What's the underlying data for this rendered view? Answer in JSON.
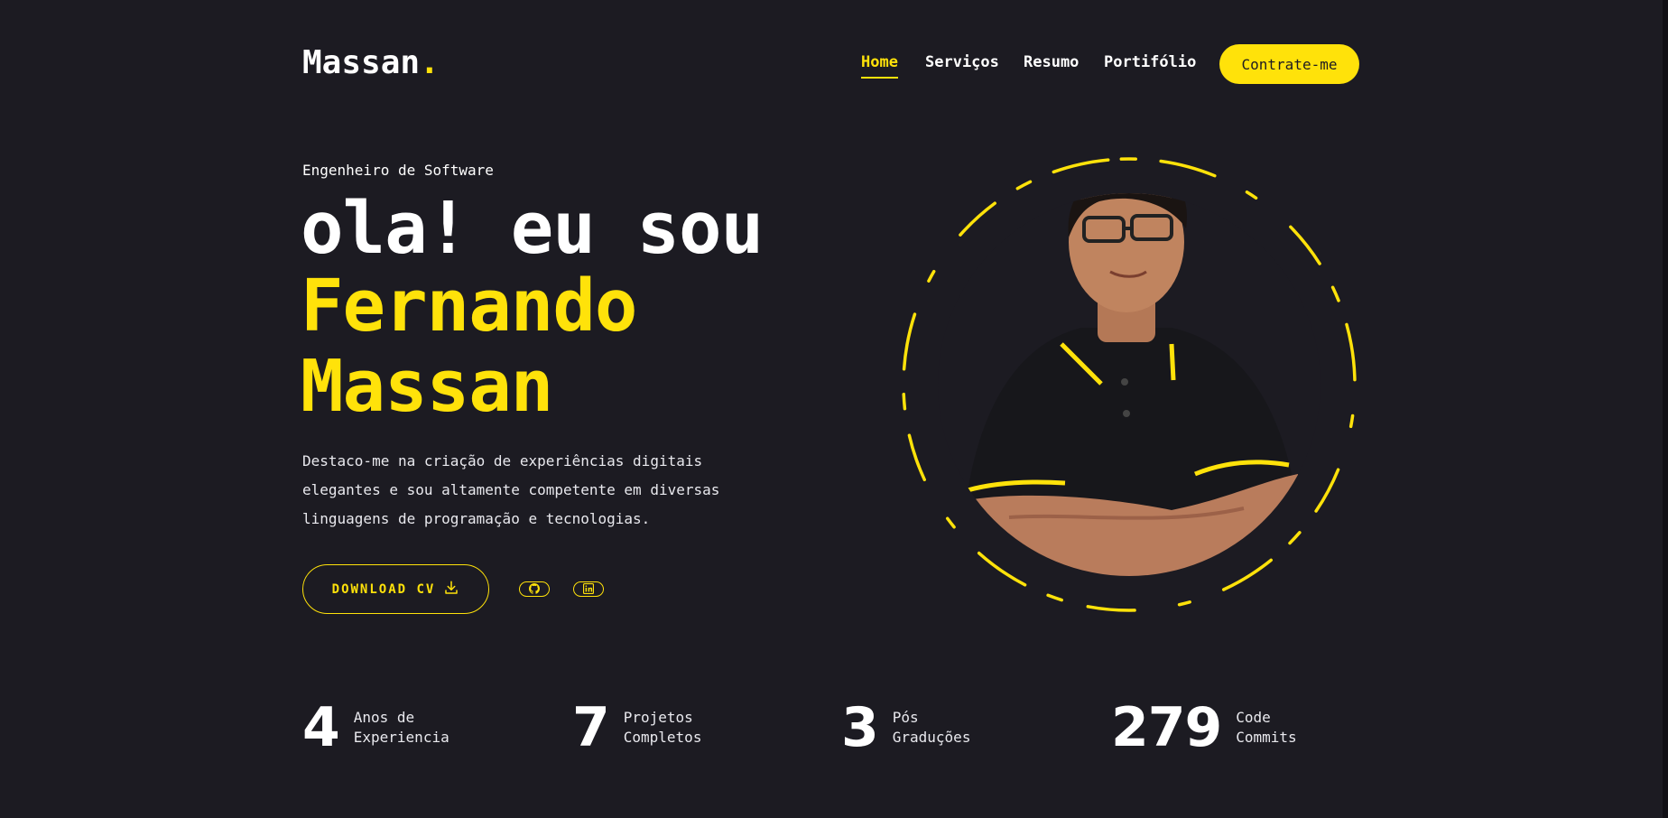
{
  "header": {
    "logo_text": "Massan",
    "logo_dot": ".",
    "nav": [
      {
        "label": "Home",
        "active": true
      },
      {
        "label": "Serviços",
        "active": false
      },
      {
        "label": "Resumo",
        "active": false
      },
      {
        "label": "Portifólio",
        "active": false
      }
    ],
    "hire_label": "Contrate-me"
  },
  "hero": {
    "subtitle": "Engenheiro de Software",
    "greeting": "ola! eu sou",
    "first_name": "Fernando",
    "last_name": "Massan",
    "description": [
      "Destaco-me na criação de experiências digitais",
      "elegantes e sou altamente competente em diversas",
      "linguagens de programação e tecnologias."
    ],
    "download_label": "DOWNLOAD CV",
    "download_icon": "download-icon",
    "social": [
      {
        "name": "github-icon"
      },
      {
        "name": "linkedin-icon"
      }
    ]
  },
  "stats": [
    {
      "number": "4",
      "label_1": "Anos de",
      "label_2": "Experiencia"
    },
    {
      "number": "7",
      "label_1": "Projetos",
      "label_2": "Completos"
    },
    {
      "number": "3",
      "label_1": "Pós",
      "label_2": "Graduções"
    },
    {
      "number": "279",
      "label_1": "Code",
      "label_2": "Commits"
    }
  ],
  "colors": {
    "background": "#1c1b22",
    "accent": "#ffe20a",
    "text": "#ffffff"
  }
}
